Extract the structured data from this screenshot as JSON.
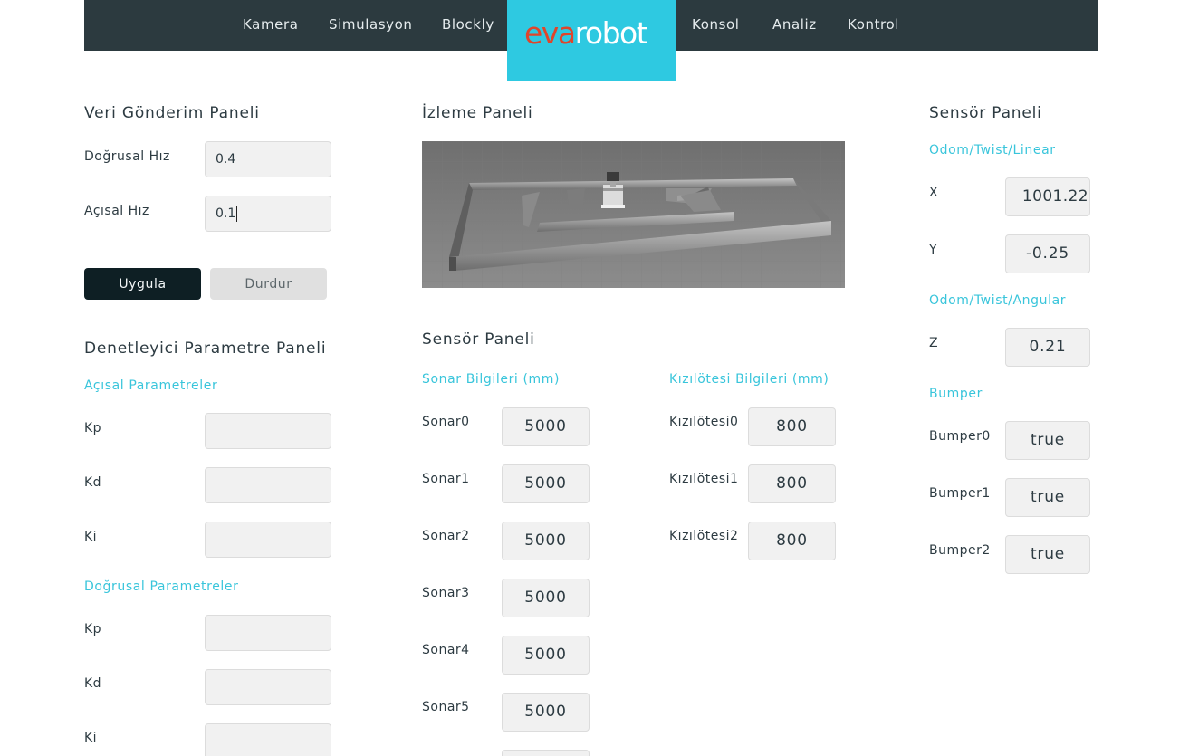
{
  "nav": {
    "items": [
      "Kamera",
      "Simulasyon",
      "Blockly",
      "Konsol",
      "Analiz",
      "Kontrol"
    ],
    "logo": {
      "part1": "eva",
      "part2": "robot"
    }
  },
  "send_panel": {
    "title": "Veri Gönderim Paneli",
    "linear_label": "Doğrusal Hız",
    "linear_value": "0.4",
    "angular_label": "Açısal Hız",
    "angular_value": "0.1",
    "apply_label": "Uygula",
    "stop_label": "Durdur"
  },
  "controller_panel": {
    "title": "Denetleyici Parametre Paneli",
    "angular_heading": "Açısal Parametreler",
    "linear_heading": "Doğrusal Parametreler",
    "kp_label": "Kp",
    "kd_label": "Kd",
    "ki_label": "Ki"
  },
  "monitor_panel": {
    "title": "İzleme Paneli"
  },
  "sensor_middle": {
    "title": "Sensör Paneli",
    "sonar_heading": "Sonar Bilgileri (mm)",
    "ir_heading": "Kızılötesi Bilgileri (mm)",
    "sonars": [
      {
        "label": "Sonar0",
        "value": "5000"
      },
      {
        "label": "Sonar1",
        "value": "5000"
      },
      {
        "label": "Sonar2",
        "value": "5000"
      },
      {
        "label": "Sonar3",
        "value": "5000"
      },
      {
        "label": "Sonar4",
        "value": "5000"
      },
      {
        "label": "Sonar5",
        "value": "5000"
      }
    ],
    "irs": [
      {
        "label": "Kızılötesi0",
        "value": "800"
      },
      {
        "label": "Kızılötesi1",
        "value": "800"
      },
      {
        "label": "Kızılötesi2",
        "value": "800"
      }
    ]
  },
  "sensor_right": {
    "title": "Sensör Paneli",
    "linear_heading": "Odom/Twist/Linear",
    "x_label": "X",
    "x_value": "1001.22",
    "y_label": "Y",
    "y_value": "-0.25",
    "angular_heading": "Odom/Twist/Angular",
    "z_label": "Z",
    "z_value": "0.21",
    "bumper_heading": "Bumper",
    "bumpers": [
      {
        "label": "Bumper0",
        "value": "true"
      },
      {
        "label": "Bumper1",
        "value": "true"
      },
      {
        "label": "Bumper2",
        "value": "true"
      }
    ]
  },
  "colors": {
    "navbar": "#2c3a3f",
    "accent": "#2ec9e1",
    "subheading": "#39c5db",
    "logo_red": "#e0452b",
    "primary_button": "#0e1f24",
    "secondary_button": "#e0e0e0"
  }
}
